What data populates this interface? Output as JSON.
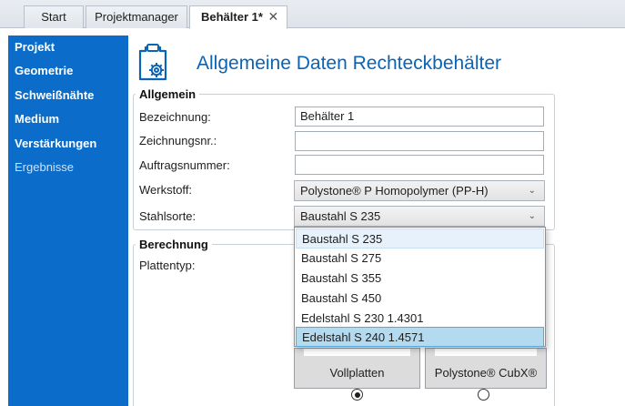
{
  "tabs": {
    "start": "Start",
    "projektmanager": "Projektmanager",
    "active": "Behälter 1*",
    "close_glyph": "✕"
  },
  "sidebar": {
    "items": [
      {
        "label": "Projekt"
      },
      {
        "label": "Geometrie"
      },
      {
        "label": "Schweißnähte"
      },
      {
        "label": "Medium"
      },
      {
        "label": "Verstärkungen"
      },
      {
        "label": "Ergebnisse"
      }
    ]
  },
  "header": {
    "icon": "clipboard-gear-icon",
    "title": "Allgemeine Daten Rechteckbehälter"
  },
  "allgemein": {
    "legend": "Allgemein",
    "bezeichnung_label": "Bezeichnung:",
    "bezeichnung_value": "Behälter 1",
    "zeichnungsnr_label": "Zeichnungsnr.:",
    "zeichnungsnr_value": "",
    "auftragsnummer_label": "Auftragsnummer:",
    "auftragsnummer_value": "",
    "werkstoff_label": "Werkstoff:",
    "werkstoff_value": "Polystone® P Homopolymer (PP-H)",
    "stahlsorte_label": "Stahlsorte:",
    "stahlsorte_value": "Baustahl S 235",
    "chevron": "⌄"
  },
  "stahlsorte_dropdown": {
    "options": [
      "Baustahl S 235",
      "Baustahl S 275",
      "Baustahl S 355",
      "Baustahl S 450",
      "Edelstahl S 230 1.4301",
      "Edelstahl S 240 1.4571"
    ],
    "highlighted": "Edelstahl S 240 1.4571"
  },
  "berechnung": {
    "legend": "Berechnung",
    "plattentyp_label": "Plattentyp:",
    "cards": [
      {
        "label": "Vollplatten",
        "selected": true
      },
      {
        "label": "Polystone® CubX®",
        "selected": false
      }
    ]
  },
  "colors": {
    "sidebar_bg": "#0b6dc9",
    "title_blue": "#0c63b4",
    "highlight": "#b4daf0"
  }
}
